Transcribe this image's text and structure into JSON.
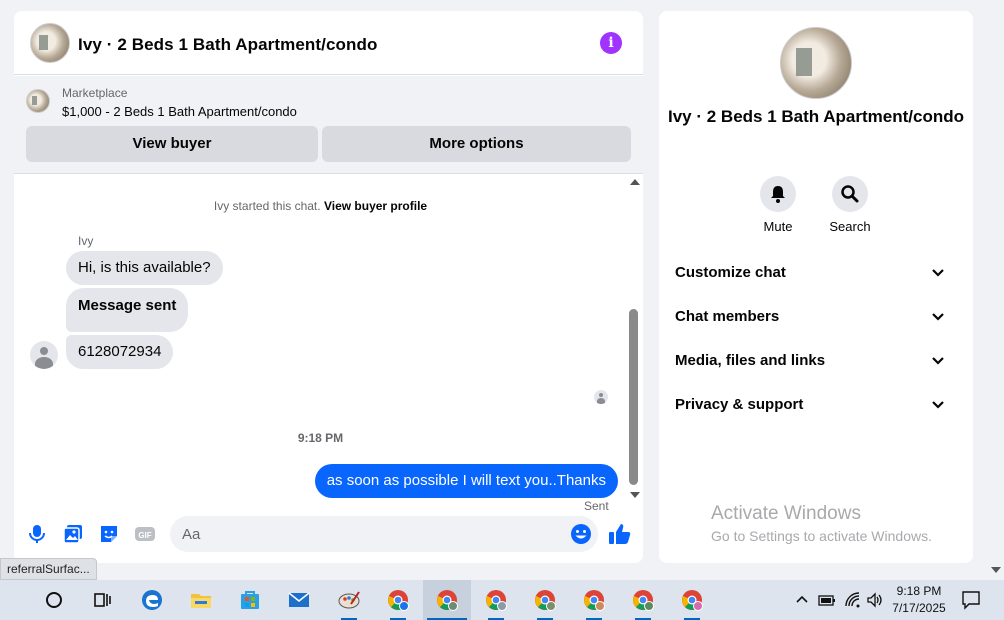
{
  "colors": {
    "accent": "#0866ff",
    "info": "#a033ff",
    "bubble_in": "#e4e6eb",
    "background": "#f0f2f5"
  },
  "chat": {
    "title": "Ivy · 2 Beds 1 Bath Apartment/condo",
    "listing": {
      "source": "Marketplace",
      "price_title": "$1,000 - 2 Beds 1 Bath Apartment/condo",
      "view_buyer_label": "View buyer",
      "more_options_label": "More options"
    },
    "thread": {
      "started_text": "Ivy started this chat.",
      "started_link": "View buyer profile",
      "sender_name": "Ivy",
      "incoming": [
        "Hi, is this available?",
        "Message sent",
        "6128072934"
      ],
      "timestamp": "9:18 PM",
      "outgoing": "as soon as possible I will text you..Thanks",
      "status": "Sent"
    },
    "composer": {
      "placeholder": "Aa"
    }
  },
  "info_panel": {
    "name": "Ivy · 2 Beds 1 Bath Apartment/condo",
    "actions": [
      {
        "label": "Mute",
        "icon": "bell-icon"
      },
      {
        "label": "Search",
        "icon": "search-icon"
      }
    ],
    "sections": [
      "Customize chat",
      "Chat members",
      "Media, files and links",
      "Privacy & support"
    ]
  },
  "watermark": {
    "title": "Activate Windows",
    "subtitle": "Go to Settings to activate Windows."
  },
  "status_url": "referralSurfac...",
  "taskbar": {
    "apps": [
      "search",
      "task-view",
      "edge",
      "file-explorer",
      "store",
      "mail",
      "paint",
      "chrome",
      "chrome",
      "chrome",
      "chrome",
      "chrome",
      "chrome",
      "chrome"
    ],
    "time": "9:18 PM",
    "date": "7/17/2025"
  }
}
